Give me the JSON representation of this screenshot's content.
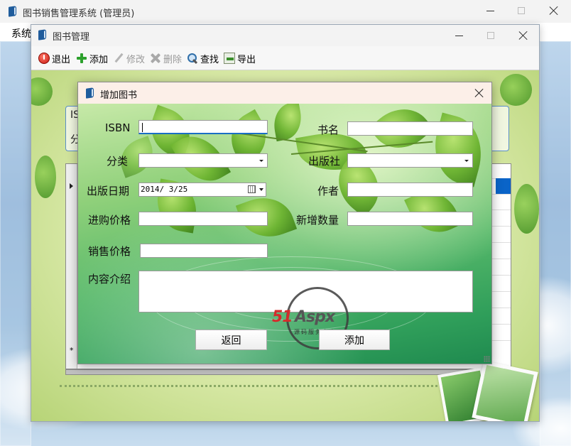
{
  "main_window": {
    "title": "图书销售管理系统 (管理员)",
    "menu": {
      "system": "系统"
    }
  },
  "book_window": {
    "title": "图书管理",
    "toolbar": {
      "exit": "退出",
      "add": "添加",
      "edit": "修改",
      "delete": "删除",
      "find": "查找",
      "export": "导出"
    },
    "partial_labels": {
      "isbn": "IS",
      "category": "分"
    },
    "grid_new_row_marker": "*"
  },
  "add_dialog": {
    "title": "增加图书",
    "fields": {
      "isbn": {
        "label": "ISBN",
        "value": ""
      },
      "title": {
        "label": "书名",
        "value": ""
      },
      "category": {
        "label": "分类",
        "value": ""
      },
      "publisher": {
        "label": "出版社",
        "value": ""
      },
      "publish_date": {
        "label": "出版日期",
        "value": "2014/ 3/25"
      },
      "author": {
        "label": "作者",
        "value": ""
      },
      "purchase_price": {
        "label": "进购价格",
        "value": ""
      },
      "quantity": {
        "label": "新增数量",
        "value": ""
      },
      "sale_price": {
        "label": "销售价格",
        "value": ""
      },
      "description": {
        "label": "内容介绍",
        "value": ""
      }
    },
    "buttons": {
      "back": "返回",
      "add": "添加"
    },
    "watermark": {
      "brand_51": "51",
      "brand_aspx": "Aspx",
      "tagline": "源码服务专家"
    }
  },
  "colors": {
    "focus_underline": "#1a6fc4",
    "selected_cell": "#0a64c8",
    "watermark_red": "#d42c2c"
  }
}
